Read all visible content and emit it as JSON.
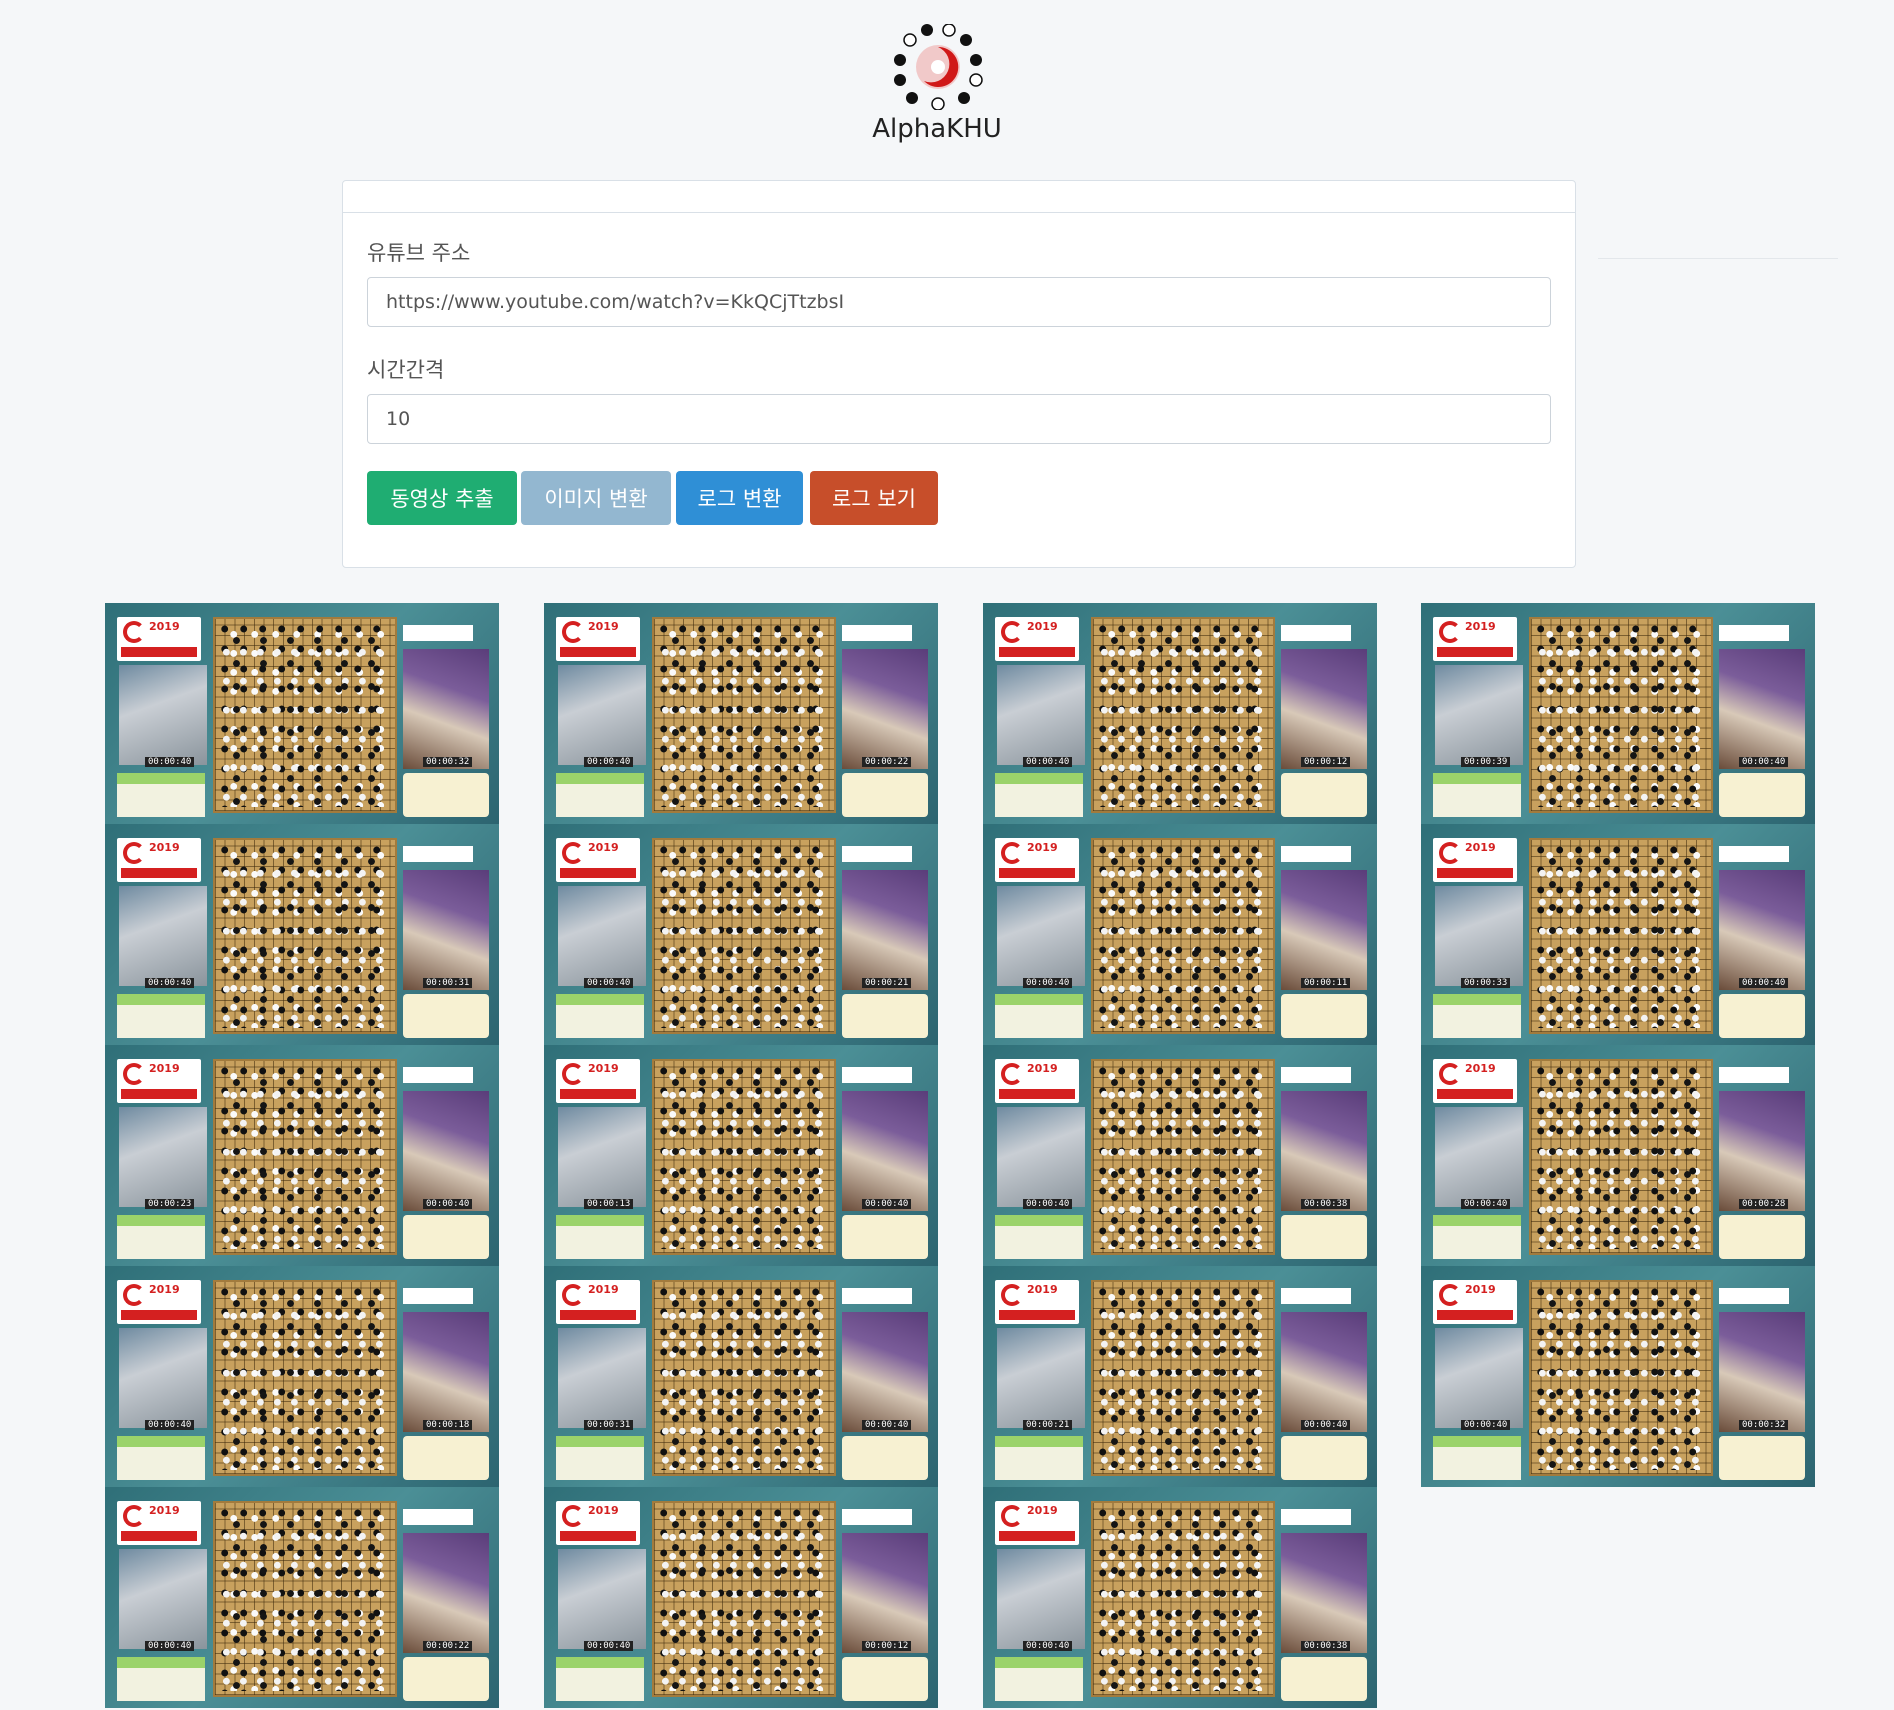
{
  "app": {
    "title": "AlphaKHU"
  },
  "form": {
    "url_label": "유튜브 주소",
    "url_value": "https://www.youtube.com/watch?v=KkQCjTtzbsI",
    "interval_label": "시간간격",
    "interval_value": "10"
  },
  "buttons": {
    "extract": "동영상 추출",
    "image_convert": "이미지 변환",
    "log_convert": "로그 변환",
    "log_view": "로그 보기"
  },
  "colors": {
    "extract": "#1fad72",
    "image_convert": "#93b7d0",
    "log_convert": "#2f8fd6",
    "log_view": "#c74e2a"
  },
  "thumbnails": {
    "columns": [
      {
        "timers": [
          [
            "00:00:40",
            "00:00:32"
          ],
          [
            "00:00:40",
            "00:00:31"
          ],
          [
            "00:00:23",
            "00:00:40"
          ],
          [
            "00:00:40",
            "00:00:18"
          ],
          [
            "00:00:40",
            "00:00:22"
          ]
        ]
      },
      {
        "timers": [
          [
            "00:00:40",
            "00:00:22"
          ],
          [
            "00:00:40",
            "00:00:21"
          ],
          [
            "00:00:13",
            "00:00:40"
          ],
          [
            "00:00:31",
            "00:00:40"
          ],
          [
            "00:00:40",
            "00:00:12"
          ]
        ]
      },
      {
        "timers": [
          [
            "00:00:40",
            "00:00:12"
          ],
          [
            "00:00:40",
            "00:00:11"
          ],
          [
            "00:00:40",
            "00:00:38"
          ],
          [
            "00:00:21",
            "00:00:40"
          ],
          [
            "00:00:40",
            "00:00:38"
          ]
        ]
      },
      {
        "timers": [
          [
            "00:00:39",
            "00:00:40"
          ],
          [
            "00:00:33",
            "00:00:40"
          ],
          [
            "00:00:40",
            "00:00:28"
          ],
          [
            "00:00:40",
            "00:00:32"
          ]
        ]
      }
    ]
  }
}
